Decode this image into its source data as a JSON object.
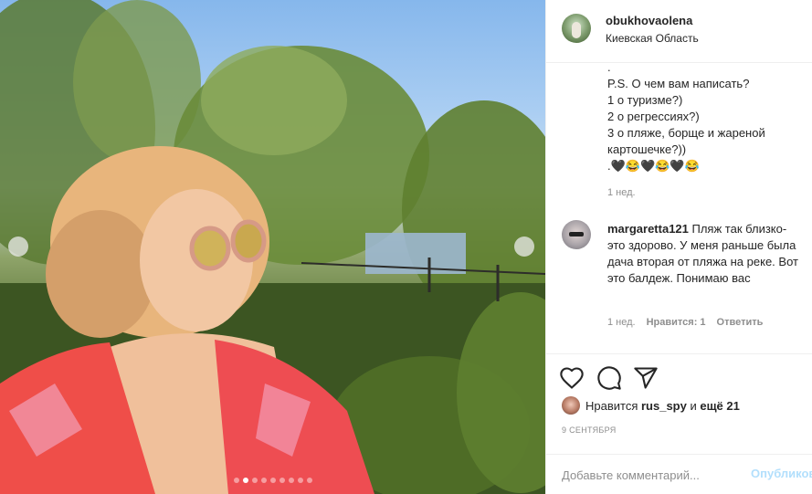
{
  "post": {
    "username": "obukhovaolena",
    "location": "Киевская Область"
  },
  "caption": {
    "lines": [
      ".",
      "P.S. О чем вам написать?",
      "1 о туризме?)",
      "2 о регрессиях?)",
      "3 о пляже, борще и жареной",
      "картошечке?))",
      ".🖤😂🖤😂🖤😂"
    ],
    "time": "1 нед."
  },
  "comment": {
    "username": "margaretta121",
    "text": " Пляж так близко- это здорово. У меня раньше была дача вторая от пляжа на реке. Вот это балдеж. Понимаю вас",
    "time": "1 нед.",
    "likes": "Нравится: 1",
    "reply": "Ответить"
  },
  "likes": {
    "prefix": "Нравится ",
    "user": "rus_spy",
    "middle": " и ",
    "rest": "ещё 21"
  },
  "date": "9 СЕНТЯБРЯ",
  "add_comment": {
    "placeholder": "Добавьте комментарий...",
    "publish": "Опубликовать"
  },
  "icons": [
    "heart-icon",
    "comment-icon",
    "share-icon",
    "prev-arrow-icon",
    "next-arrow-icon"
  ],
  "carousel": {
    "count": 9,
    "active": 1
  }
}
